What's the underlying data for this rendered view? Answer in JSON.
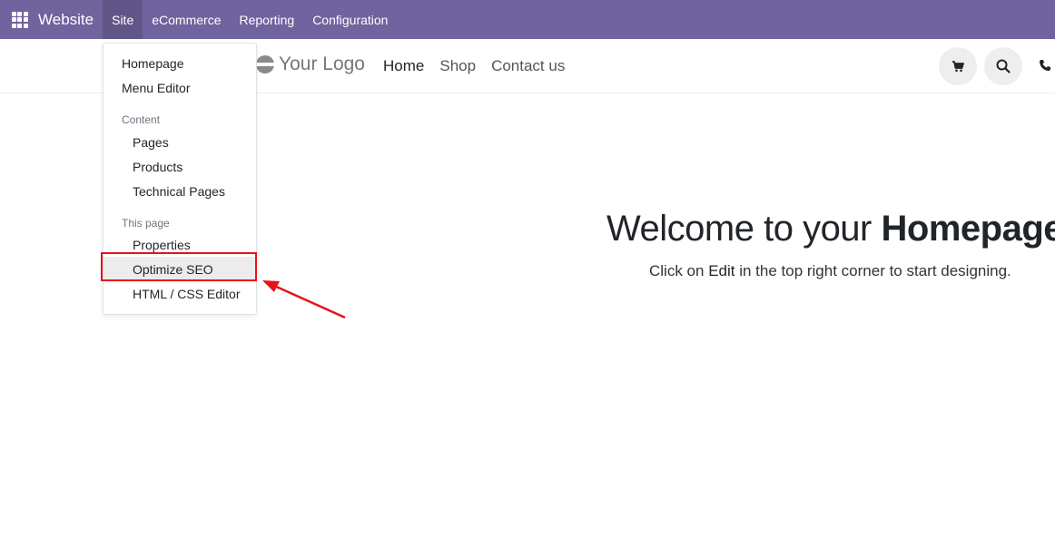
{
  "topbar": {
    "app_name": "Website",
    "menu": [
      "Site",
      "eCommerce",
      "Reporting",
      "Configuration"
    ],
    "active_menu": "Site",
    "color": "#71639e"
  },
  "site_header": {
    "logo_text": "Your Logo",
    "nav": [
      "Home",
      "Shop",
      "Contact us"
    ],
    "current_nav": "Home",
    "icons": [
      "cart-icon",
      "search-icon",
      "phone-icon"
    ]
  },
  "site_menu": {
    "items_top": [
      "Homepage",
      "Menu Editor"
    ],
    "content_header": "Content",
    "content_items": [
      "Pages",
      "Products",
      "Technical Pages"
    ],
    "this_page_header": "This page",
    "this_page_items": [
      "Properties",
      "Optimize SEO",
      "HTML / CSS Editor"
    ],
    "highlighted_item": "Optimize SEO",
    "annotation_color": "#e8101a"
  },
  "hero": {
    "title_prefix": "Welcome to your ",
    "title_bold": "Homepage",
    "sub_prefix": "Click on ",
    "sub_edit": "Edit",
    "sub_suffix": " in the top right corner to start designing."
  }
}
